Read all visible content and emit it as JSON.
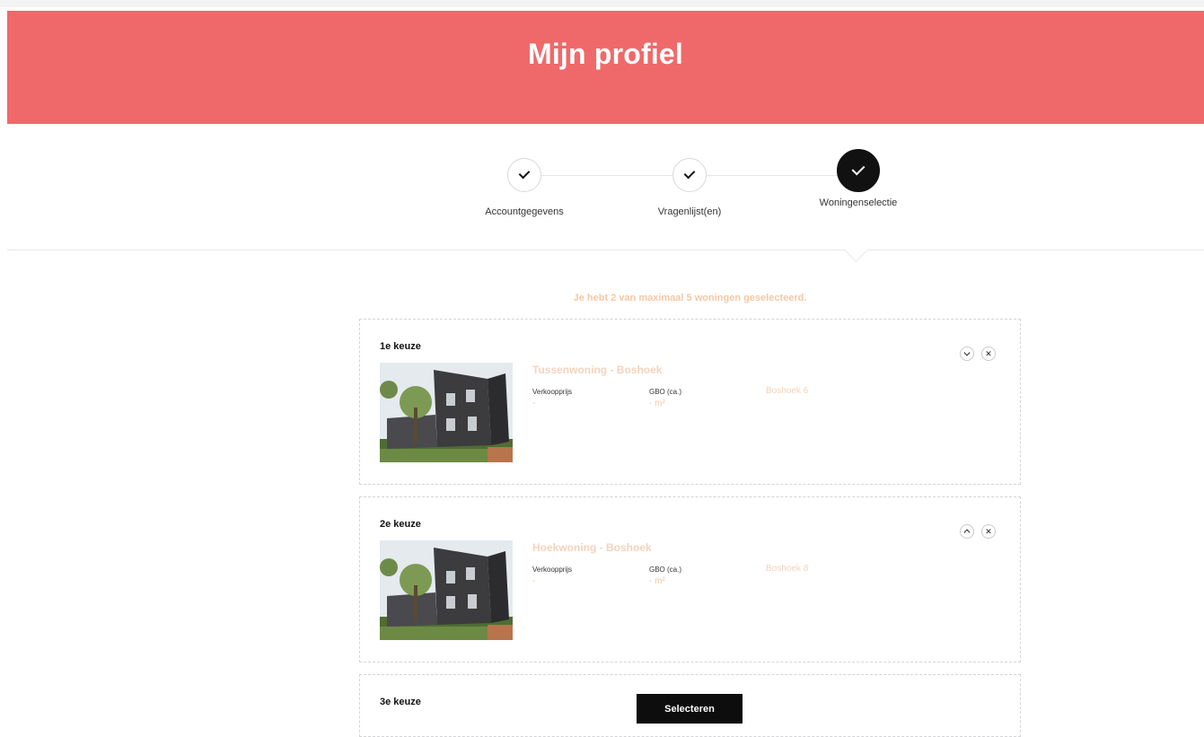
{
  "header": {
    "title": "Mijn profiel"
  },
  "steps": [
    {
      "label": "Accountgegevens",
      "icon": "check-icon",
      "state": "done"
    },
    {
      "label": "Vragenlijst(en)",
      "icon": "check-icon",
      "state": "done"
    },
    {
      "label": "Woningenselectie",
      "icon": "check-icon",
      "state": "active"
    }
  ],
  "selection": {
    "notice": "Je hebt 2 van maximaal 5 woningen geselecteerd.",
    "cards": [
      {
        "title": "1e keuze",
        "name": "Tussenwoning - Boshoek",
        "price_label": "Verkoopprijs",
        "price_value": "-",
        "area_label": "GBO (ca.)",
        "area_value": "- m²",
        "address": "Boshoek 6",
        "controls": [
          "chevron-down-icon",
          "close-icon"
        ]
      },
      {
        "title": "2e keuze",
        "name": "Hoekwoning - Boshoek",
        "price_label": "Verkoopprijs",
        "price_value": "-",
        "area_label": "GBO (ca.)",
        "area_value": "- m²",
        "address": "Boshoek 8",
        "controls": [
          "chevron-up-icon",
          "close-icon"
        ]
      },
      {
        "title": "3e keuze",
        "button_label": "Selecteren"
      }
    ]
  },
  "colors": {
    "header_bg": "#f0696a",
    "accent_peach": "#f3c8a6",
    "button_bg": "#0d0d0d"
  }
}
